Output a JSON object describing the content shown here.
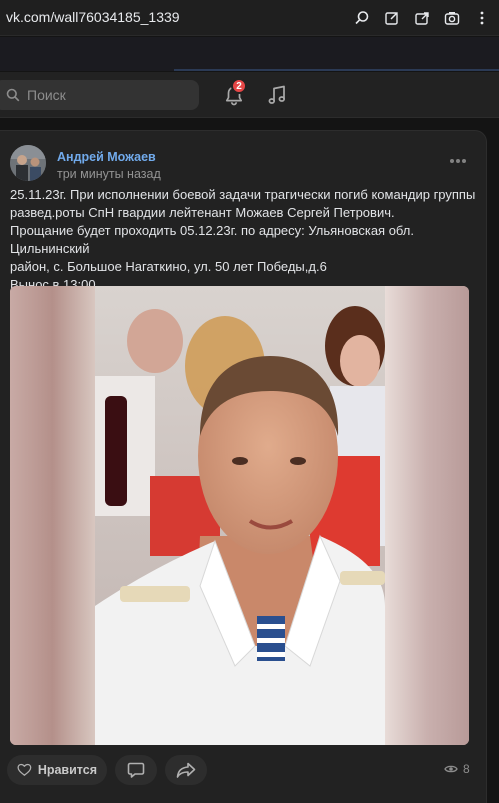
{
  "browser": {
    "url": "vk.com/wall76034185_1339",
    "icons": [
      "search-icon",
      "edit-page-icon",
      "share-icon",
      "screenshot-icon",
      "more-icon"
    ]
  },
  "header": {
    "search_placeholder": "Поиск",
    "notifications_count": "2",
    "icons": [
      "bell-icon",
      "music-icon"
    ]
  },
  "post": {
    "author": "Андрей Можаев",
    "time": "три минуты назад",
    "text_lines": [
      "25.11.23г. При исполнении боевой задачи трагически погиб командир группы",
      "развед.роты СпН гвардии лейтенант Можаев Сергей Петрович.",
      "Прощание будет проходить 05.12.23г. по адресу: Ульяновская обл. Цильнинский",
      "район, с. Большое Нагаткино, ул. 50 лет Победы,д.6",
      "Вынос в 13:00."
    ],
    "like_label": "Нравится",
    "views": "8"
  },
  "colors": {
    "accent": "#71aaeb",
    "badge": "#e64646",
    "background": "#141414",
    "card": "#222222"
  }
}
